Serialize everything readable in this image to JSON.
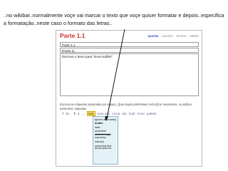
{
  "caption": "..no wikibar..normalmente voçe vai marcar o texto que voçe quiser formatar e depois..especifica a formatação..neste caso o formato das letras..",
  "tiddler": {
    "title": "Parte 1.1",
    "toolbar": [
      "quardar",
      "cancelar",
      "eliminar",
      "wikibar"
    ],
    "title_field": "Parte 1.1",
    "tags_field": "[Parte 1]",
    "body_field": "Escreva o texto para \"Novo tiddler\""
  },
  "hint": "Escreva as etiquetas separadas por espaço, [[use duplo parênteses rectos]] se necessário, ou atribua existentes: etiquetas",
  "formatbar": {
    "items": [
      "?",
      "H…",
      "¶",
      "1",
      "…",
      "text",
      "para.syn",
      "comp",
      "dat",
      "tmpl",
      "more",
      "palette"
    ],
    "active_index": 5
  },
  "format_menu": {
    "items": [
      {
        "label": "ignore wikimarkup",
        "style": ""
      },
      {
        "label": "bolder",
        "style": "b"
      },
      {
        "label": "italic",
        "style": "i"
      },
      {
        "label": "underline",
        "style": "u"
      },
      {
        "label": "strikethrough",
        "style": "s"
      },
      {
        "label": "superscript",
        "style": "sup"
      },
      {
        "label": "subscript",
        "style": "sub"
      },
      {
        "label": "comment text",
        "style": ""
      },
      {
        "label": "monospaced",
        "style": "mono"
      }
    ]
  },
  "colors": {
    "title": "#cc3333",
    "menu_bg": "#e4f2f7",
    "active_tab": "#ffe26a"
  }
}
